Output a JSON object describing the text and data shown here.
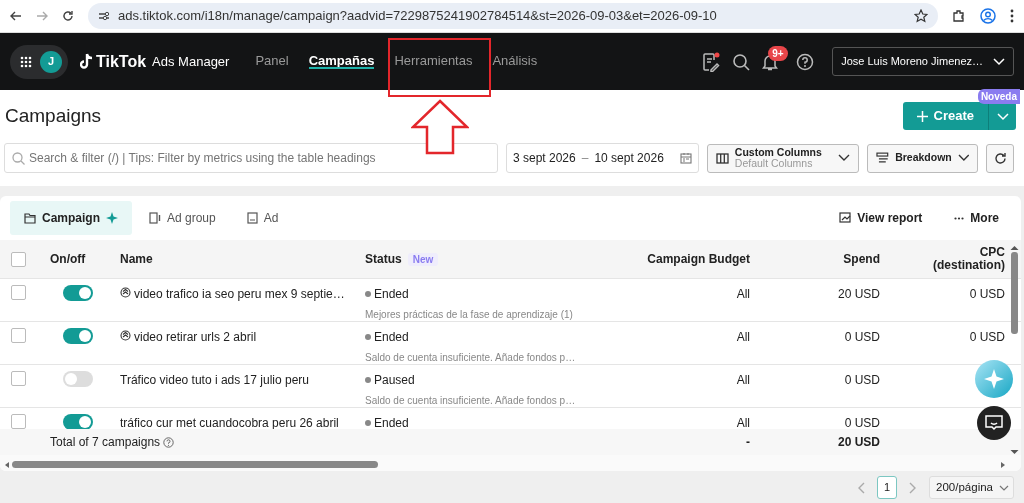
{
  "browser": {
    "url": "ads.tiktok.com/i18n/manage/campaign?aadvid=7229875241902784514&st=2026-09-03&et=2026-09-10"
  },
  "nav": {
    "avatar": "J",
    "logo": "TikTok",
    "product": "Ads Manager",
    "items": [
      {
        "label": "Panel",
        "selected": false
      },
      {
        "label": "Campañas",
        "selected": true
      },
      {
        "label": "Herramientas",
        "selected": false
      },
      {
        "label": "Análisis",
        "selected": false
      }
    ],
    "notifications": "9+",
    "account": "Jose Luis Moreno Jimenez…"
  },
  "header": {
    "title": "Campaigns",
    "create": "Create",
    "new_tag": "Noveda"
  },
  "filters": {
    "placeholder": "Search & filter (/) | Tips: Filter by metrics using the table headings",
    "date_start": "3 sept 2026",
    "date_sep": "–",
    "date_end": "10 sept 2026",
    "columns_title": "Custom Columns",
    "columns_sub": "Default Columns",
    "breakdown": "Breakdown"
  },
  "levels": [
    {
      "label": "Campaign",
      "selected": true
    },
    {
      "label": "Ad group",
      "selected": false
    },
    {
      "label": "Ad",
      "selected": false
    }
  ],
  "actions": {
    "view_report": "View report",
    "more": "More"
  },
  "table": {
    "checked": false,
    "columns": [
      "On/off",
      "Name",
      "Status",
      "Campaign Budget",
      "Spend",
      "CPC (destination)"
    ],
    "status_badge": "New",
    "rows": [
      {
        "checked": false,
        "on": true,
        "has_icon": true,
        "name": "video trafico ia seo peru mex 9 septie…",
        "status": "Ended",
        "note": "Mejores prácticas de la fase de aprendizaje (1)",
        "budget": "All",
        "spend": "20 USD",
        "cpc": "0 USD"
      },
      {
        "checked": false,
        "on": true,
        "has_icon": true,
        "name": "video retirar urls 2 abril",
        "status": "Ended",
        "note": "Saldo de cuenta insuficiente. Añade fondos p…",
        "budget": "All",
        "spend": "0 USD",
        "cpc": "0 USD"
      },
      {
        "checked": false,
        "on": false,
        "has_icon": false,
        "name": "Tráfico video tuto i ads 17 julio peru",
        "status": "Paused",
        "note": "Saldo de cuenta insuficiente. Añade fondos p…",
        "budget": "All",
        "spend": "0 USD"
      },
      {
        "checked": false,
        "on": true,
        "has_icon": false,
        "name": "tráfico cur met cuandocobra peru 26 abril",
        "status": "Ended",
        "budget": "All",
        "spend": "0 USD"
      }
    ],
    "total": {
      "label": "Total of 7 campaigns",
      "budget": "-",
      "spend": "20 USD"
    }
  },
  "pagination": {
    "page": "1",
    "per_page": "200/página"
  }
}
